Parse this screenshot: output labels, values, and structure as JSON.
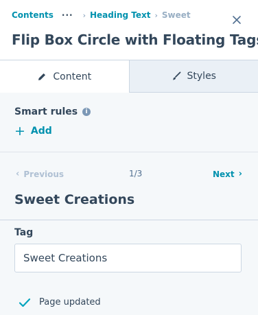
{
  "breadcrumb": {
    "root": "Contents",
    "ellipsis": "···",
    "parent": "Heading Text",
    "current": "Sweet"
  },
  "title": "Flip Box Circle with Floating Tags",
  "tabs": [
    {
      "label": "Content",
      "icon": "pencil-icon",
      "active": true
    },
    {
      "label": "Styles",
      "icon": "brush-icon",
      "active": false
    }
  ],
  "smart_rules": {
    "label": "Smart rules",
    "info_icon": "i",
    "add_label": "Add",
    "add_icon": "+"
  },
  "pager": {
    "previous": "Previous",
    "position": "1/3",
    "next": "Next"
  },
  "item": {
    "heading": "Sweet Creations",
    "field_label": "Tag",
    "field_value": "Sweet Creations"
  },
  "status": {
    "text": "Page updated",
    "icon": "check-icon"
  },
  "colors": {
    "accent": "#0091ae",
    "text": "#33475b",
    "panel_bg": "#f5f8fa",
    "tab_inactive_bg": "#eaf0f6",
    "border": "#cbd6e2"
  }
}
